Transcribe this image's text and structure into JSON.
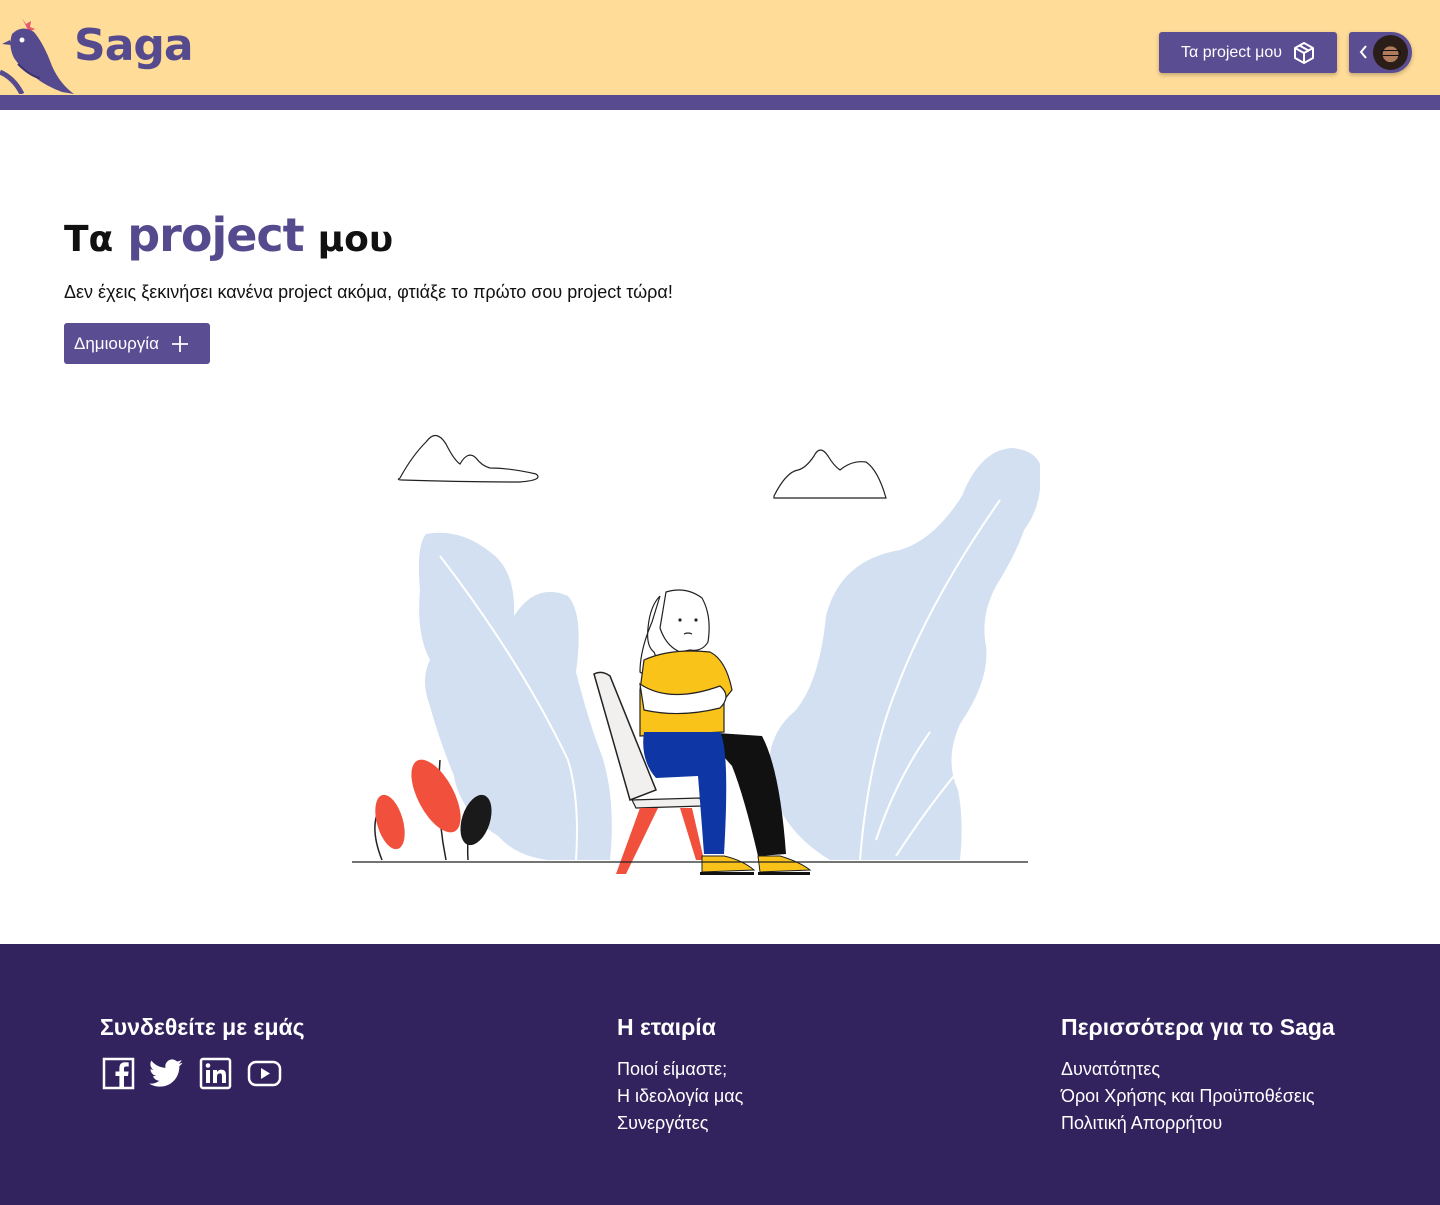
{
  "header": {
    "logo_text": "Saga",
    "nav_projects_label": "Τα project μου"
  },
  "main": {
    "title_part1": "Τα",
    "title_accent": "project",
    "title_part3": "μου",
    "empty_message": "Δεν έχεις ξεκινήσει κανένα project ακόμα, φτιάξε το πρώτο σου project τώρα!",
    "create_button_label": "Δημιουργία"
  },
  "footer": {
    "connect": {
      "heading": "Συνδεθείτε με εμάς",
      "socials": [
        "facebook-icon",
        "twitter-icon",
        "linkedin-icon",
        "youtube-icon"
      ]
    },
    "company": {
      "heading": "Η εταιρία",
      "links": [
        "Ποιοί είμαστε;",
        "Η ιδεολογία μας",
        "Συνεργάτες"
      ]
    },
    "more": {
      "heading": "Περισσότερα για το Saga",
      "links": [
        "Δυνατότητες",
        "Όροι Χρήσης και Προϋποθέσεις",
        "Πολιτική Απορρήτου"
      ]
    }
  },
  "colors": {
    "header_bg": "#ffdc98",
    "brand_purple": "#5b4d92",
    "footer_bg": "#32235e"
  }
}
